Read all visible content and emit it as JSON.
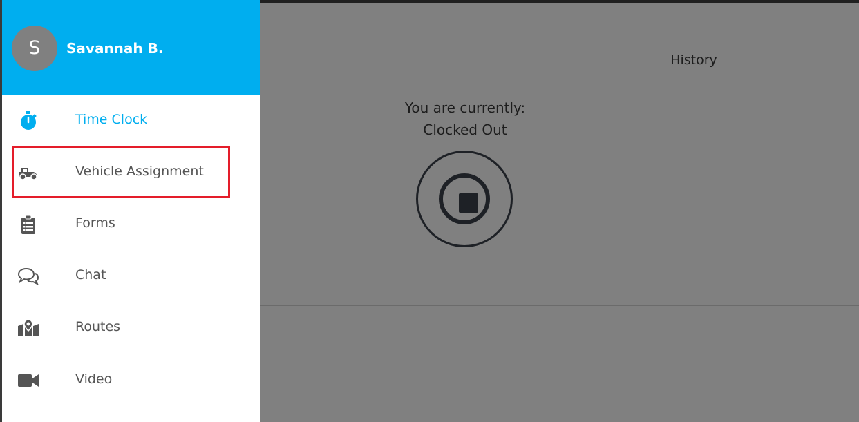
{
  "drawer": {
    "avatar_initial": "S",
    "user_name": "Savannah B.",
    "items": [
      {
        "label": "Time Clock",
        "icon": "stopwatch-icon",
        "active": true
      },
      {
        "label": "Vehicle Assignment",
        "icon": "truck-icon",
        "active": false
      },
      {
        "label": "Forms",
        "icon": "clipboard-icon",
        "active": false
      },
      {
        "label": "Chat",
        "icon": "chat-bubbles-icon",
        "active": false
      },
      {
        "label": "Routes",
        "icon": "map-marker-icon",
        "active": false
      },
      {
        "label": "Video",
        "icon": "video-camera-icon",
        "active": false
      }
    ]
  },
  "main": {
    "history_tab": "History",
    "status_line1": "You are currently:",
    "status_line2": "Clocked Out"
  },
  "colors": {
    "accent": "#00aeef",
    "overlay_gray": "#808080",
    "highlight": "#e41d2a"
  }
}
